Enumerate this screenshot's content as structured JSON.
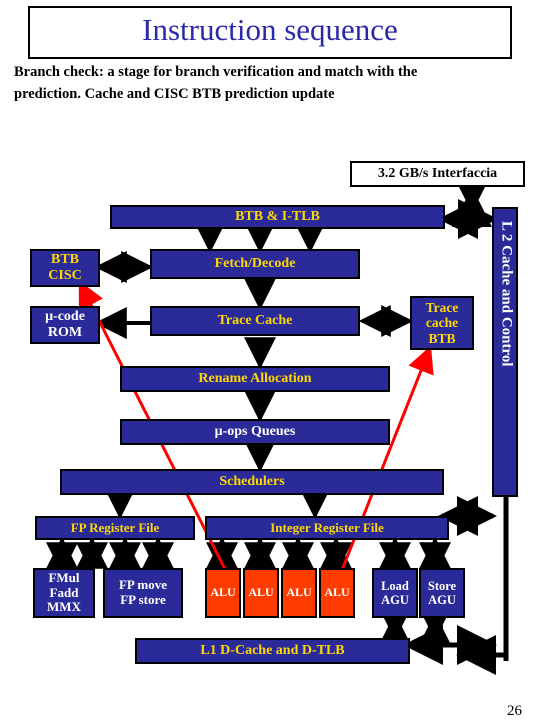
{
  "title": "Instruction sequence",
  "subtitle_1": "Branch check: a stage for branch verification and match with the",
  "subtitle_2": "prediction. Cache and CISC BTB prediction update",
  "labels": {
    "interface": "3.2 GB/s Interfaccia",
    "btb_itlb": "BTB & I-TLB",
    "btb_cisc_1": "BTB",
    "btb_cisc_2": "CISC",
    "fetch_decode": "Fetch/Decode",
    "ucode_rom_1": "μ-code",
    "ucode_rom_2": "ROM",
    "trace_cache": "Trace Cache",
    "trace_cache_btb_1": "Trace",
    "trace_cache_btb_2": "cache",
    "trace_cache_btb_3": "BTB",
    "rename_alloc": "Rename Allocation",
    "uops_queues": "μ-ops Queues",
    "schedulers": "Schedulers",
    "fp_regfile": "FP Register File",
    "int_regfile": "Integer Register File",
    "fmul_1": "FMul",
    "fmul_2": "Fadd",
    "fmul_3": "MMX",
    "fpmove_1": "FP move",
    "fpmove_2": "FP store",
    "alu": "ALU",
    "load_1": "Load",
    "load_2": "AGU",
    "store_1": "Store",
    "store_2": "AGU",
    "l1d": "L1 D-Cache and D-TLB",
    "l2": "L 2 Cache and Control"
  },
  "slide_number": "26"
}
